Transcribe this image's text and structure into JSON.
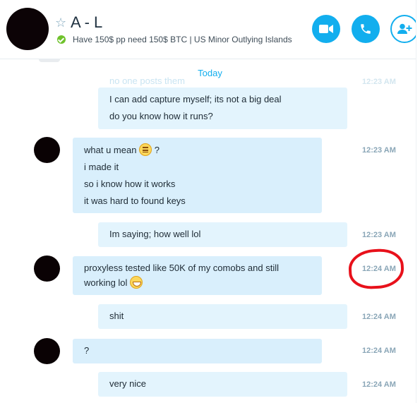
{
  "header": {
    "contact_name": "A - L",
    "mood": "Have 150$ pp need 150$ BTC  |  US Minor Outlying Islands",
    "icons": {
      "favorite": "star-outline-icon",
      "video": "video-call-icon",
      "call": "phone-call-icon",
      "add": "add-contact-icon",
      "status": "online-check-icon"
    },
    "accent_color": "#12aeee"
  },
  "chat": {
    "day_divider": "Today",
    "ghost_message": "no one posts them",
    "ghost_time": "12:23 AM",
    "messages": [
      {
        "from": "me",
        "lines": [
          "I can add capture myself; its not a big deal",
          "do you know how it runs?"
        ],
        "time": ""
      },
      {
        "from": "contact",
        "lines": [
          "what u mean",
          "i made it",
          "so i know how it works",
          "it was hard to found keys"
        ],
        "line1_suffix": "?",
        "emoji": "neutral-face-emoji",
        "time": "12:23 AM"
      },
      {
        "from": "me",
        "lines": [
          "Im saying; how well lol"
        ],
        "time": "12:23 AM"
      },
      {
        "from": "contact",
        "lines": [
          "proxyless tested like 50K of my comobs and still",
          "working lol"
        ],
        "emoji": "grinning-face-emoji",
        "time": "12:24 AM"
      },
      {
        "from": "me",
        "lines": [
          "shit"
        ],
        "time": "12:24 AM"
      },
      {
        "from": "contact",
        "lines": [
          "?"
        ],
        "time": "12:24 AM"
      },
      {
        "from": "me",
        "lines": [
          "very nice"
        ],
        "time": "12:24 AM"
      }
    ],
    "annotation_color": "#e8111b"
  }
}
